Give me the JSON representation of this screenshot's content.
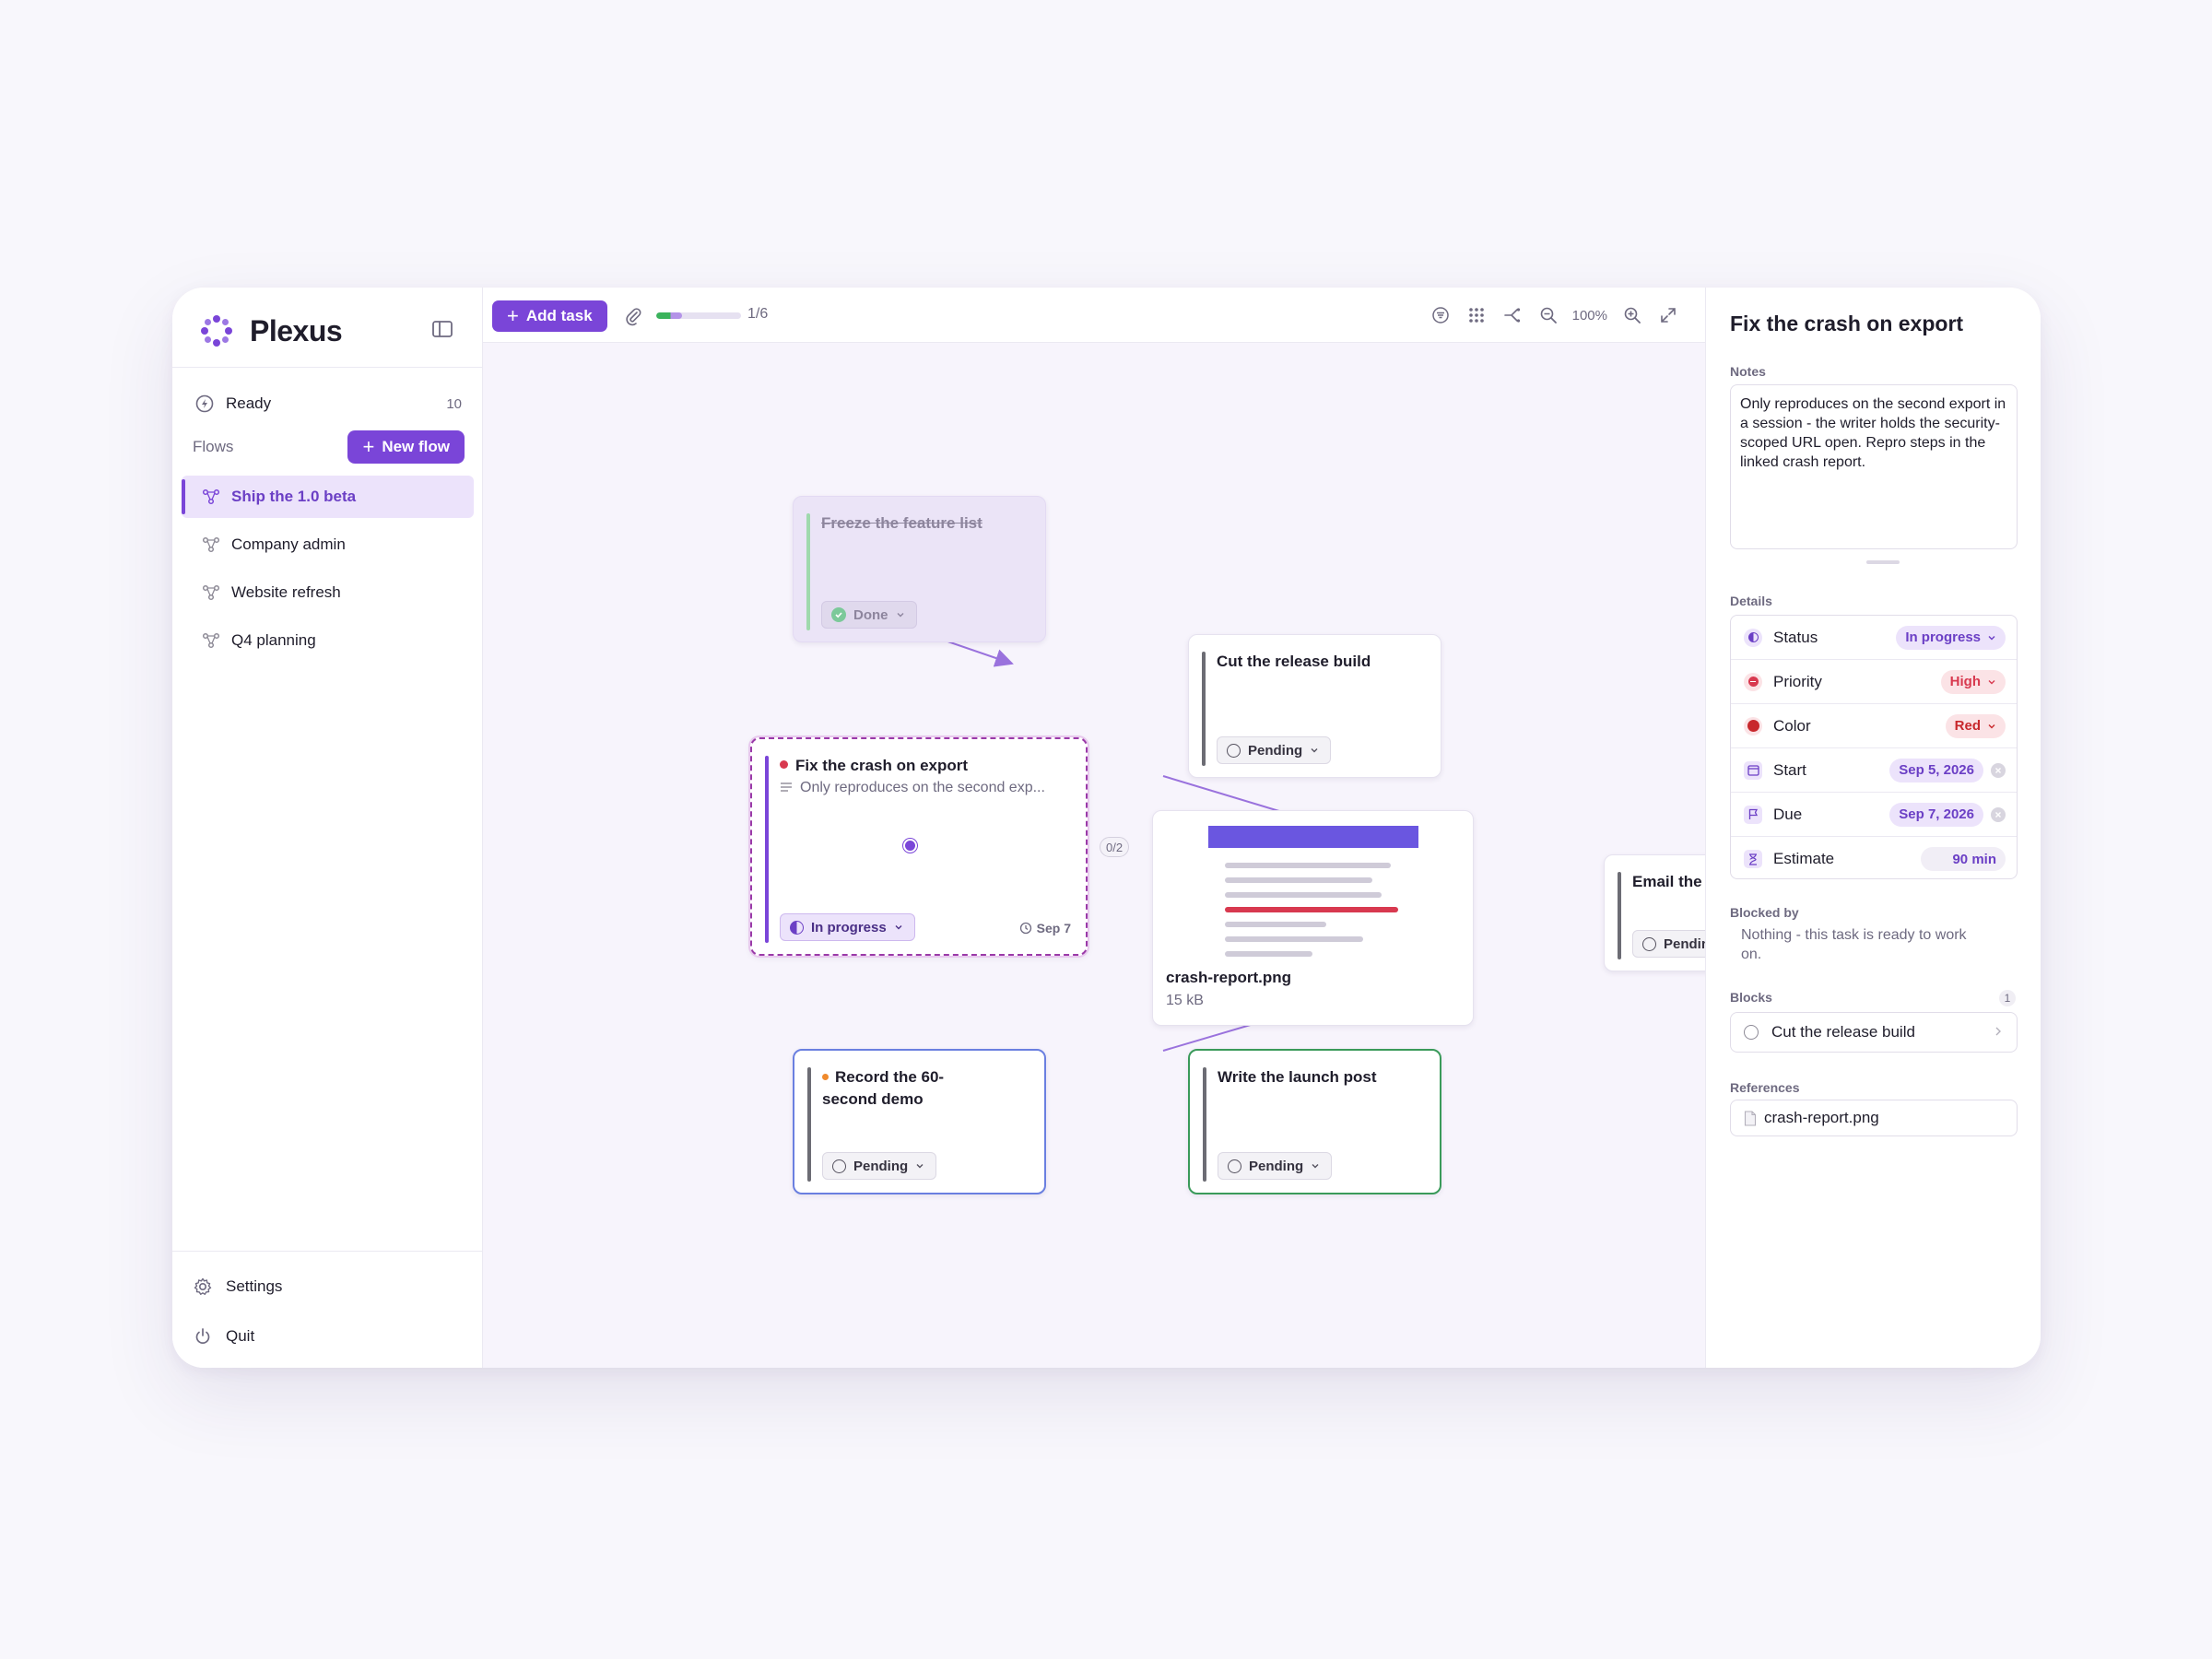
{
  "app": {
    "name": "Plexus"
  },
  "colors": {
    "accent": "#7a45d8",
    "high": "#d8394f",
    "red": "#c8282c",
    "done": "#3bb35c"
  },
  "sidebar": {
    "ready_label": "Ready",
    "ready_count": "10",
    "flows_label": "Flows",
    "new_flow_label": "New flow",
    "flows": [
      "Ship the 1.0 beta",
      "Company admin",
      "Website refresh",
      "Q4 planning"
    ],
    "active_flow": "Ship the 1.0 beta",
    "settings_label": "Settings",
    "quit_label": "Quit"
  },
  "toolbar": {
    "add_task_label": "Add task",
    "progress_text": "1/6",
    "progress_fraction": 0.17,
    "zoom_text": "100%",
    "icons": [
      "filter-icon",
      "grid-icon",
      "layout-icon",
      "zoom-out-icon",
      "zoom-in-icon",
      "fit-icon"
    ]
  },
  "canvas": {
    "cards": {
      "freeze": {
        "title": "Freeze the feature list",
        "status": "Done"
      },
      "cut": {
        "title": "Cut the release build",
        "status": "Pending"
      },
      "fix": {
        "title": "Fix the crash on export",
        "note": "Only reproduces on the second exp...",
        "status": "In progress",
        "due": "Sep 7",
        "subtasks": "0/2"
      },
      "record": {
        "title": "Record the 60-second demo",
        "status": "Pending"
      },
      "write": {
        "title": "Write the launch post",
        "status": "Pending"
      },
      "email": {
        "title": "Email the beta list",
        "status": "Pending"
      }
    },
    "attachment": {
      "name": "crash-report.png",
      "size": "15 kB"
    }
  },
  "inspector": {
    "title": "Fix the crash on export",
    "notes_label": "Notes",
    "notes": "Only reproduces on the second export in a session - the writer holds the security-scoped URL open. Repro steps in the linked crash report.",
    "details_label": "Details",
    "details": {
      "status_label": "Status",
      "status_value": "In progress",
      "priority_label": "Priority",
      "priority_value": "High",
      "color_label": "Color",
      "color_value": "Red",
      "start_label": "Start",
      "start_value": "Sep 5, 2026",
      "due_label": "Due",
      "due_value": "Sep 7, 2026",
      "estimate_label": "Estimate",
      "estimate_value": "90 min"
    },
    "blocked_by_label": "Blocked by",
    "blocked_by_text": "Nothing - this task is ready to work on.",
    "blocks_label": "Blocks",
    "blocks_count": "1",
    "blocks_item": "Cut the release build",
    "references_label": "References",
    "reference_item": "crash-report.png"
  }
}
